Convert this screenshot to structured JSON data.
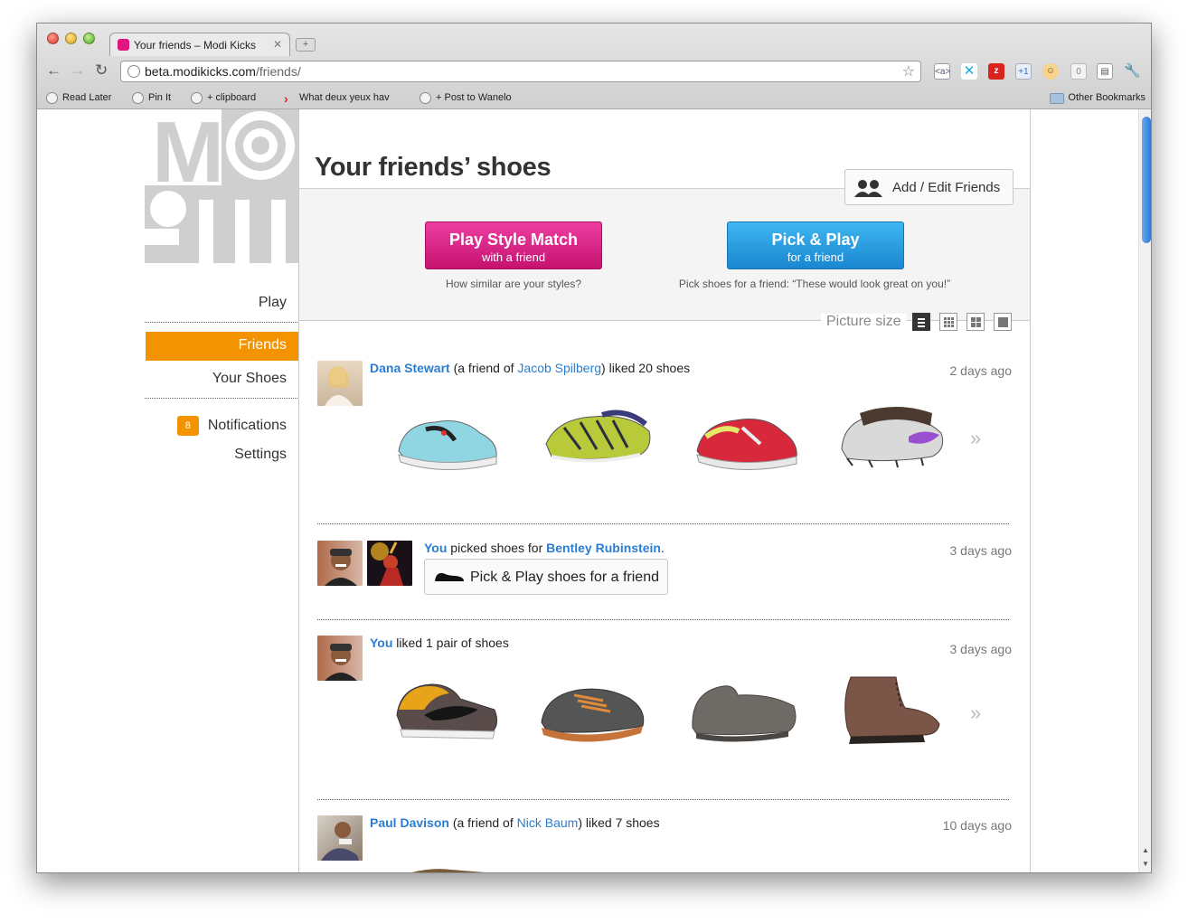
{
  "browser": {
    "tab_title": "Your friends – Modi Kicks",
    "tab_close": "✕",
    "new_tab": "+",
    "url_host": "beta.modikicks.com",
    "url_path": "/friends/",
    "ext_counter": "0",
    "bookmarks": [
      {
        "label": "Read Later"
      },
      {
        "label": "Pin It"
      },
      {
        "label": "+ clipboard"
      },
      {
        "label": "What deux yeux hav"
      },
      {
        "label": "+ Post to Wanelo"
      }
    ],
    "other_bookmarks": "Other Bookmarks"
  },
  "sidebar": {
    "logo_letters": "MO",
    "play": "Play",
    "friends": "Friends",
    "your_shoes": "Your Shoes",
    "notifications": "Notifications",
    "notifications_count": "8",
    "settings": "Settings"
  },
  "main": {
    "title": "Your friends’ shoes",
    "add_edit_friends": "Add / Edit Friends",
    "style_match": {
      "title": "Play Style Match",
      "subtitle": "with a friend",
      "caption": "How similar are your styles?"
    },
    "pick_play": {
      "title": "Pick & Play",
      "subtitle": "for a friend",
      "caption": "Pick shoes for a friend: “These would look great on you!”"
    },
    "picture_size_label": "Picture size"
  },
  "feed": [
    {
      "name": "Dana Stewart",
      "pre": "(a friend of ",
      "friend": "Jacob Spilberg",
      "post": ") liked 20 shoes",
      "time": "2 days ago"
    },
    {
      "name": "You",
      "pre": " picked shoes for ",
      "friend": "Bentley Rubinstein",
      "post": ".",
      "time": "3 days ago",
      "button": "Pick & Play shoes for a friend"
    },
    {
      "name": "You",
      "post": " liked 1 pair of shoes",
      "time": "3 days ago"
    },
    {
      "name": "Paul Davison",
      "pre": "(a friend of ",
      "friend": "Nick Baum",
      "post": ") liked 7 shoes",
      "time": "10 days ago"
    }
  ],
  "more_arrow": "»",
  "colors": {
    "accent_orange": "#f39300",
    "pink": "#e0157f",
    "blue": "#2a7ed2"
  }
}
